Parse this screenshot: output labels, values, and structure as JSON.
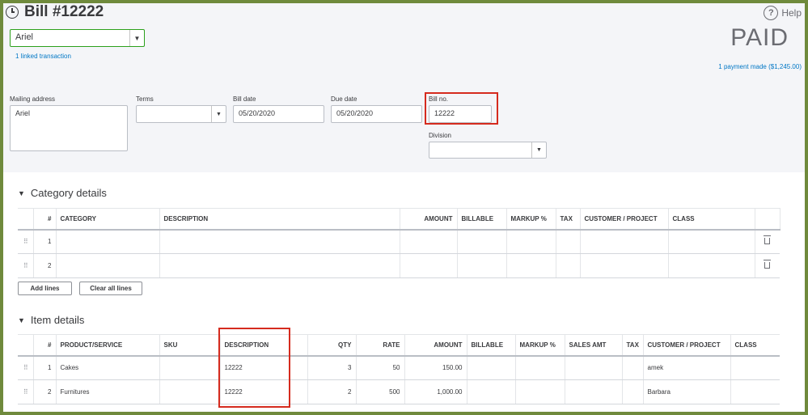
{
  "bill": {
    "title": "Bill #12222",
    "help_label": "Help",
    "vendor": "Ariel",
    "linked_transaction": "1 linked transaction",
    "status": "PAID",
    "payment_made": "1 payment made ($1,245.00)"
  },
  "fields": {
    "mailing_address_label": "Mailing address",
    "mailing_address_value": "Ariel",
    "terms_label": "Terms",
    "terms_value": "",
    "bill_date_label": "Bill date",
    "bill_date_value": "05/20/2020",
    "due_date_label": "Due date",
    "due_date_value": "05/20/2020",
    "bill_no_label": "Bill no.",
    "bill_no_value": "12222",
    "division_label": "Division",
    "division_value": ""
  },
  "category": {
    "section_title": "Category details",
    "headers": [
      "#",
      "CATEGORY",
      "DESCRIPTION",
      "AMOUNT",
      "BILLABLE",
      "MARKUP %",
      "TAX",
      "CUSTOMER / PROJECT",
      "CLASS"
    ],
    "rows": [
      {
        "num": "1",
        "category": "",
        "description": "",
        "amount": "",
        "customer": "",
        "class": ""
      },
      {
        "num": "2",
        "category": "",
        "description": "",
        "amount": "",
        "customer": "",
        "class": ""
      }
    ],
    "add_lines": "Add lines",
    "clear_all_lines": "Clear all lines"
  },
  "items": {
    "section_title": "Item details",
    "headers": [
      "#",
      "PRODUCT/SERVICE",
      "SKU",
      "DESCRIPTION",
      "QTY",
      "RATE",
      "AMOUNT",
      "BILLABLE",
      "MARKUP %",
      "SALES AMT",
      "TAX",
      "CUSTOMER / PROJECT",
      "CLASS"
    ],
    "rows": [
      {
        "num": "1",
        "product": "Cakes",
        "sku": "",
        "description": "12222",
        "qty": "3",
        "rate": "50",
        "amount": "150.00",
        "customer": "amek"
      },
      {
        "num": "2",
        "product": "Furnitures",
        "sku": "",
        "description": "12222",
        "qty": "2",
        "rate": "500",
        "amount": "1,000.00",
        "customer": "Barbara"
      }
    ]
  },
  "icons": {
    "title": "clock-history-icon",
    "help": "question-circle-icon",
    "caret": "chevron-down-icon",
    "section_toggle": "triangle-down-icon",
    "drag": "drag-handle-icon",
    "delete": "trash-icon"
  },
  "colors": {
    "frame_border": "#6f8a3c",
    "header_bg": "#f4f5f8",
    "link": "#0077c5",
    "vendor_border": "#2ca01c",
    "highlight": "#d52b1e"
  }
}
